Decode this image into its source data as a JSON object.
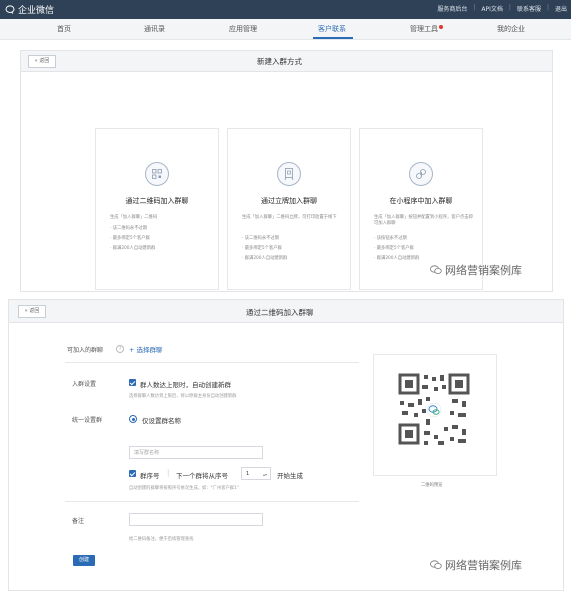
{
  "topbar": {
    "logo": "企业微信",
    "links": [
      "服务商后台",
      "API文档",
      "联系客服",
      "退出"
    ]
  },
  "nav": {
    "items": [
      "首页",
      "通讯录",
      "应用管理",
      "客户联系",
      "管理工具",
      "我的企业"
    ],
    "active": "客户联系"
  },
  "panel1": {
    "back_label": "« 返回",
    "title": "新建入群方式",
    "cards": [
      {
        "icon": "qrcode-icon",
        "title": "通过二维码加入群聊",
        "desc": "生成「加入群聊」二维码",
        "bullets": [
          "· 该二维码永不过期",
          "· 最多绑定5个客户群",
          "· 群满200人自动建新群"
        ]
      },
      {
        "icon": "standee-icon",
        "title": "通过立牌加入群聊",
        "desc": "生成「加入群聊」二维码立牌，可打印放置于线下",
        "bullets": [
          "· 该二维码永不过期",
          "· 最多绑定5个客户群",
          "· 群满200人自动建新群"
        ]
      },
      {
        "icon": "miniprogram-icon",
        "title": "在小程序中加入群聊",
        "desc": "生成「加入群聊」按钮并配置到小程序，客户点击即可加入群聊",
        "bullets": [
          "· 该按钮永不过期",
          "· 最多绑定5个客户群",
          "· 群满200人自动建新群"
        ]
      }
    ]
  },
  "watermark": "网络营销案例库",
  "panel2": {
    "back_label": "« 返回",
    "title": "通过二维码加入群聊",
    "group_label": "可加入的群聊",
    "choose_group": "+ 选择群聊",
    "join_setting_label": "入群设置",
    "auto_create_label": "群人数达上限时，自动创建新群",
    "auto_create_hint": "选择群聊人数达到上限后，将以原群主身份自动创建新群",
    "unify_label": "统一设置群",
    "only_name_label": "仅设置群名称",
    "group_name_placeholder": "填写群名称",
    "seq_label": "群序号",
    "next_seq_label": "下一个群将从序号",
    "seq_value": "1",
    "seq_start_label": "开始生成",
    "seq_hint": "自动创建的群聊将按照序号依次生成，如：\"广州客户群1\"",
    "remark_label": "备注",
    "remark_hint": "给二维码备注，便于后续管理查找",
    "create_button": "创建",
    "qr_caption": "二维码预览"
  }
}
